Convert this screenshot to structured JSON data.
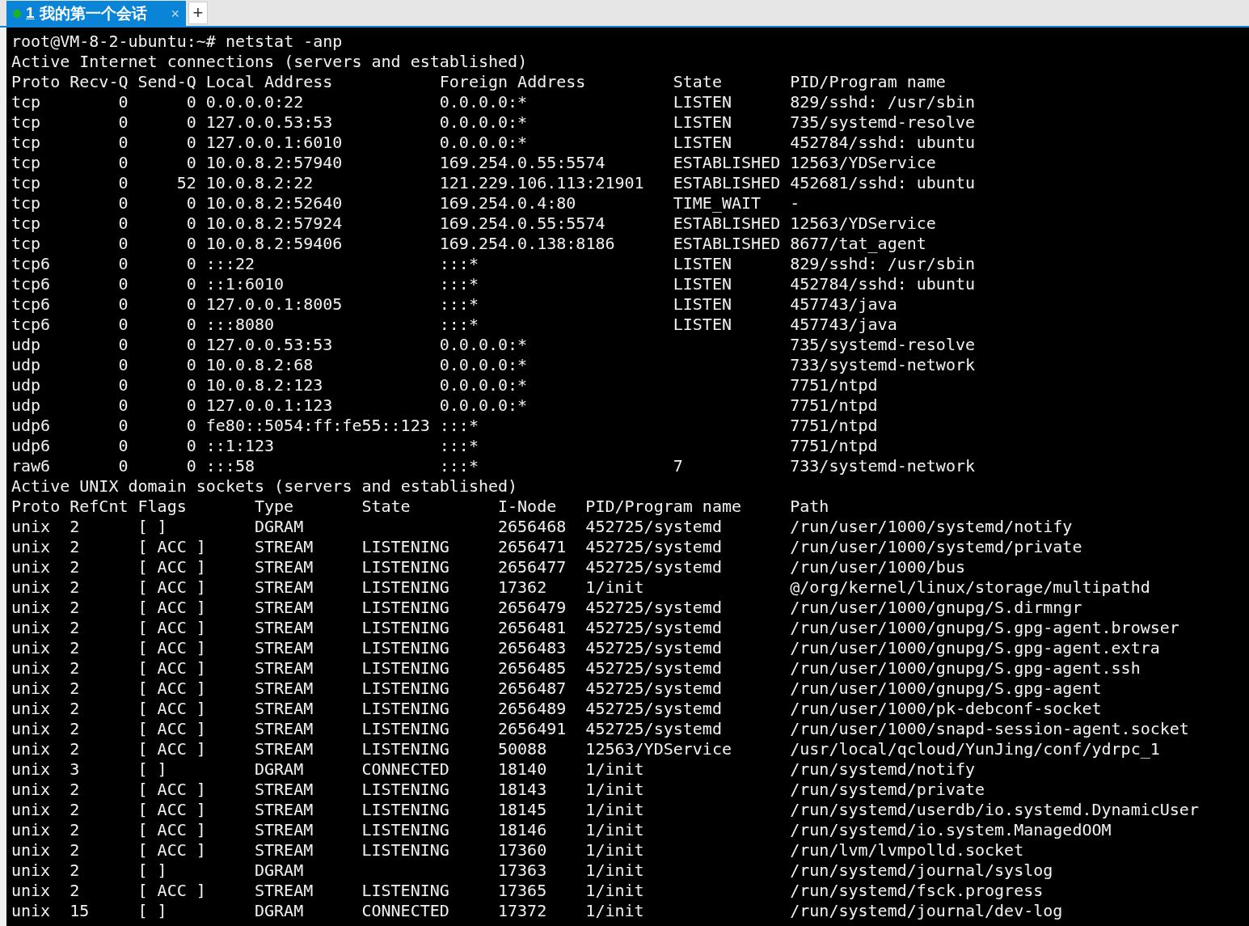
{
  "tabs": [
    {
      "number": "1",
      "title": "我的第一个会话",
      "selected": true,
      "close": "×",
      "connected": true
    }
  ],
  "new_tab": "+",
  "terminal": {
    "command_line": "root@VM-8-2-ubuntu:~# netstat -anp",
    "internet_heading": "Active Internet connections (servers and established)",
    "internet_columns": [
      "Proto",
      "Recv-Q",
      "Send-Q",
      "Local Address",
      "Foreign Address",
      "State",
      "PID/Program name"
    ],
    "internet_rows": [
      [
        "tcp",
        "0",
        "0",
        "0.0.0.0:22",
        "0.0.0.0:*",
        "LISTEN",
        "829/sshd: /usr/sbin"
      ],
      [
        "tcp",
        "0",
        "0",
        "127.0.0.53:53",
        "0.0.0.0:*",
        "LISTEN",
        "735/systemd-resolve"
      ],
      [
        "tcp",
        "0",
        "0",
        "127.0.0.1:6010",
        "0.0.0.0:*",
        "LISTEN",
        "452784/sshd: ubuntu"
      ],
      [
        "tcp",
        "0",
        "0",
        "10.0.8.2:57940",
        "169.254.0.55:5574",
        "ESTABLISHED",
        "12563/YDService"
      ],
      [
        "tcp",
        "0",
        "52",
        "10.0.8.2:22",
        "121.229.106.113:21901",
        "ESTABLISHED",
        "452681/sshd: ubuntu"
      ],
      [
        "tcp",
        "0",
        "0",
        "10.0.8.2:52640",
        "169.254.0.4:80",
        "TIME_WAIT",
        "-"
      ],
      [
        "tcp",
        "0",
        "0",
        "10.0.8.2:57924",
        "169.254.0.55:5574",
        "ESTABLISHED",
        "12563/YDService"
      ],
      [
        "tcp",
        "0",
        "0",
        "10.0.8.2:59406",
        "169.254.0.138:8186",
        "ESTABLISHED",
        "8677/tat_agent"
      ],
      [
        "tcp6",
        "0",
        "0",
        ":::22",
        ":::*",
        "LISTEN",
        "829/sshd: /usr/sbin"
      ],
      [
        "tcp6",
        "0",
        "0",
        "::1:6010",
        ":::*",
        "LISTEN",
        "452784/sshd: ubuntu"
      ],
      [
        "tcp6",
        "0",
        "0",
        "127.0.0.1:8005",
        ":::*",
        "LISTEN",
        "457743/java"
      ],
      [
        "tcp6",
        "0",
        "0",
        ":::8080",
        ":::*",
        "LISTEN",
        "457743/java"
      ],
      [
        "udp",
        "0",
        "0",
        "127.0.0.53:53",
        "0.0.0.0:*",
        null,
        "735/systemd-resolve"
      ],
      [
        "udp",
        "0",
        "0",
        "10.0.8.2:68",
        "0.0.0.0:*",
        null,
        "733/systemd-network"
      ],
      [
        "udp",
        "0",
        "0",
        "10.0.8.2:123",
        "0.0.0.0:*",
        null,
        "7751/ntpd"
      ],
      [
        "udp",
        "0",
        "0",
        "127.0.0.1:123",
        "0.0.0.0:*",
        null,
        "7751/ntpd"
      ],
      [
        "udp6",
        "0",
        "0",
        "fe80::5054:ff:fe55::123",
        ":::*",
        null,
        "7751/ntpd"
      ],
      [
        "udp6",
        "0",
        "0",
        "::1:123",
        ":::*",
        null,
        "7751/ntpd"
      ],
      [
        "raw6",
        "0",
        "0",
        ":::58",
        ":::*",
        "7",
        "733/systemd-network"
      ]
    ],
    "unix_heading": "Active UNIX domain sockets (servers and established)",
    "unix_columns": [
      "Proto",
      "RefCnt",
      "Flags",
      "Type",
      "State",
      "I-Node",
      "PID/Program name",
      "Path"
    ],
    "unix_rows": [
      [
        "unix",
        "2",
        "[ ]",
        "DGRAM",
        null,
        "2656468",
        "452725/systemd",
        "/run/user/1000/systemd/notify"
      ],
      [
        "unix",
        "2",
        "[ ACC ]",
        "STREAM",
        "LISTENING",
        "2656471",
        "452725/systemd",
        "/run/user/1000/systemd/private"
      ],
      [
        "unix",
        "2",
        "[ ACC ]",
        "STREAM",
        "LISTENING",
        "2656477",
        "452725/systemd",
        "/run/user/1000/bus"
      ],
      [
        "unix",
        "2",
        "[ ACC ]",
        "STREAM",
        "LISTENING",
        "17362",
        "1/init",
        "@/org/kernel/linux/storage/multipathd"
      ],
      [
        "unix",
        "2",
        "[ ACC ]",
        "STREAM",
        "LISTENING",
        "2656479",
        "452725/systemd",
        "/run/user/1000/gnupg/S.dirmngr"
      ],
      [
        "unix",
        "2",
        "[ ACC ]",
        "STREAM",
        "LISTENING",
        "2656481",
        "452725/systemd",
        "/run/user/1000/gnupg/S.gpg-agent.browser"
      ],
      [
        "unix",
        "2",
        "[ ACC ]",
        "STREAM",
        "LISTENING",
        "2656483",
        "452725/systemd",
        "/run/user/1000/gnupg/S.gpg-agent.extra"
      ],
      [
        "unix",
        "2",
        "[ ACC ]",
        "STREAM",
        "LISTENING",
        "2656485",
        "452725/systemd",
        "/run/user/1000/gnupg/S.gpg-agent.ssh"
      ],
      [
        "unix",
        "2",
        "[ ACC ]",
        "STREAM",
        "LISTENING",
        "2656487",
        "452725/systemd",
        "/run/user/1000/gnupg/S.gpg-agent"
      ],
      [
        "unix",
        "2",
        "[ ACC ]",
        "STREAM",
        "LISTENING",
        "2656489",
        "452725/systemd",
        "/run/user/1000/pk-debconf-socket"
      ],
      [
        "unix",
        "2",
        "[ ACC ]",
        "STREAM",
        "LISTENING",
        "2656491",
        "452725/systemd",
        "/run/user/1000/snapd-session-agent.socket"
      ],
      [
        "unix",
        "2",
        "[ ACC ]",
        "STREAM",
        "LISTENING",
        "50088",
        "12563/YDService",
        "/usr/local/qcloud/YunJing/conf/ydrpc_1"
      ],
      [
        "unix",
        "3",
        "[ ]",
        "DGRAM",
        "CONNECTED",
        "18140",
        "1/init",
        "/run/systemd/notify"
      ],
      [
        "unix",
        "2",
        "[ ACC ]",
        "STREAM",
        "LISTENING",
        "18143",
        "1/init",
        "/run/systemd/private"
      ],
      [
        "unix",
        "2",
        "[ ACC ]",
        "STREAM",
        "LISTENING",
        "18145",
        "1/init",
        "/run/systemd/userdb/io.systemd.DynamicUser"
      ],
      [
        "unix",
        "2",
        "[ ACC ]",
        "STREAM",
        "LISTENING",
        "18146",
        "1/init",
        "/run/systemd/io.system.ManagedOOM"
      ],
      [
        "unix",
        "2",
        "[ ACC ]",
        "STREAM",
        "LISTENING",
        "17360",
        "1/init",
        "/run/lvm/lvmpolld.socket"
      ],
      [
        "unix",
        "2",
        "[ ]",
        "DGRAM",
        null,
        "17363",
        "1/init",
        "/run/systemd/journal/syslog"
      ],
      [
        "unix",
        "2",
        "[ ACC ]",
        "STREAM",
        "LISTENING",
        "17365",
        "1/init",
        "/run/systemd/fsck.progress"
      ],
      [
        "unix",
        "15",
        "[ ]",
        "DGRAM",
        "CONNECTED",
        "17372",
        "1/init",
        "/run/systemd/journal/dev-log"
      ]
    ]
  }
}
